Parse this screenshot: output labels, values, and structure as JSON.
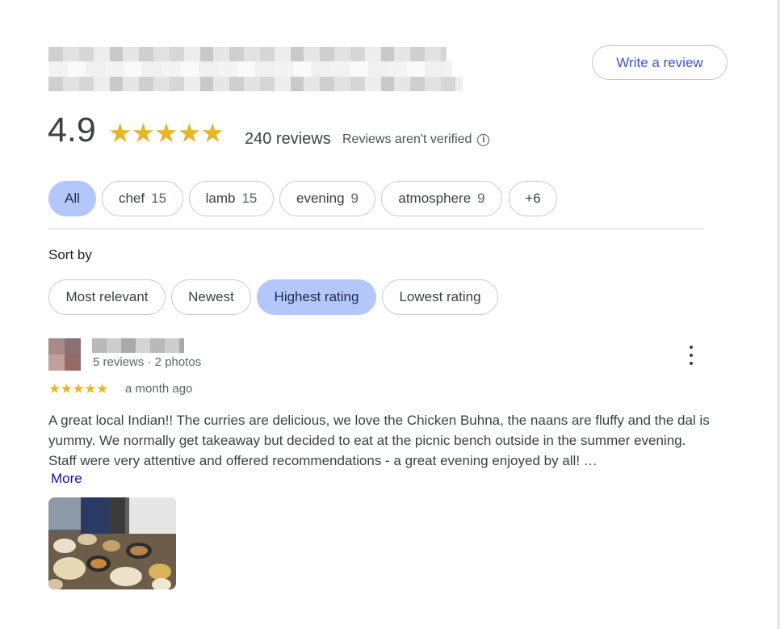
{
  "header": {
    "write_review_label": "Write a review"
  },
  "summary": {
    "rating": "4.9",
    "stars": "★★★★★",
    "review_count": "240 reviews",
    "verified_note": "Reviews aren't verified",
    "info_icon": "i"
  },
  "topics": [
    {
      "label": "All",
      "count": "",
      "active": true
    },
    {
      "label": "chef",
      "count": "15"
    },
    {
      "label": "lamb",
      "count": "15"
    },
    {
      "label": "evening",
      "count": "9"
    },
    {
      "label": "atmosphere",
      "count": "9"
    },
    {
      "label": "+6",
      "count": ""
    }
  ],
  "sort": {
    "label": "Sort by",
    "options": [
      "Most relevant",
      "Newest",
      "Highest rating",
      "Lowest rating"
    ],
    "selected": "Highest rating"
  },
  "review": {
    "meta": "5 reviews · 2 photos",
    "stars": "★★★★★",
    "time_ago": "a month ago",
    "text": "A great local Indian!! The curries are delicious, we love the Chicken Buhna, the naans are fluffy and the dal is yummy. We normally get takeaway but decided to eat at the picnic bench outside in the summer evening. Staff were very attentive and offered recommendations - a great evening enjoyed by all! …",
    "more_label": "More"
  },
  "colors": {
    "star": "#e5b52a",
    "chip_active": "#b4c7fb",
    "link": "#1a0dab",
    "write_review": "#3d56cc"
  },
  "icons": {
    "info": "info-icon",
    "menu": "more-vert-icon"
  }
}
